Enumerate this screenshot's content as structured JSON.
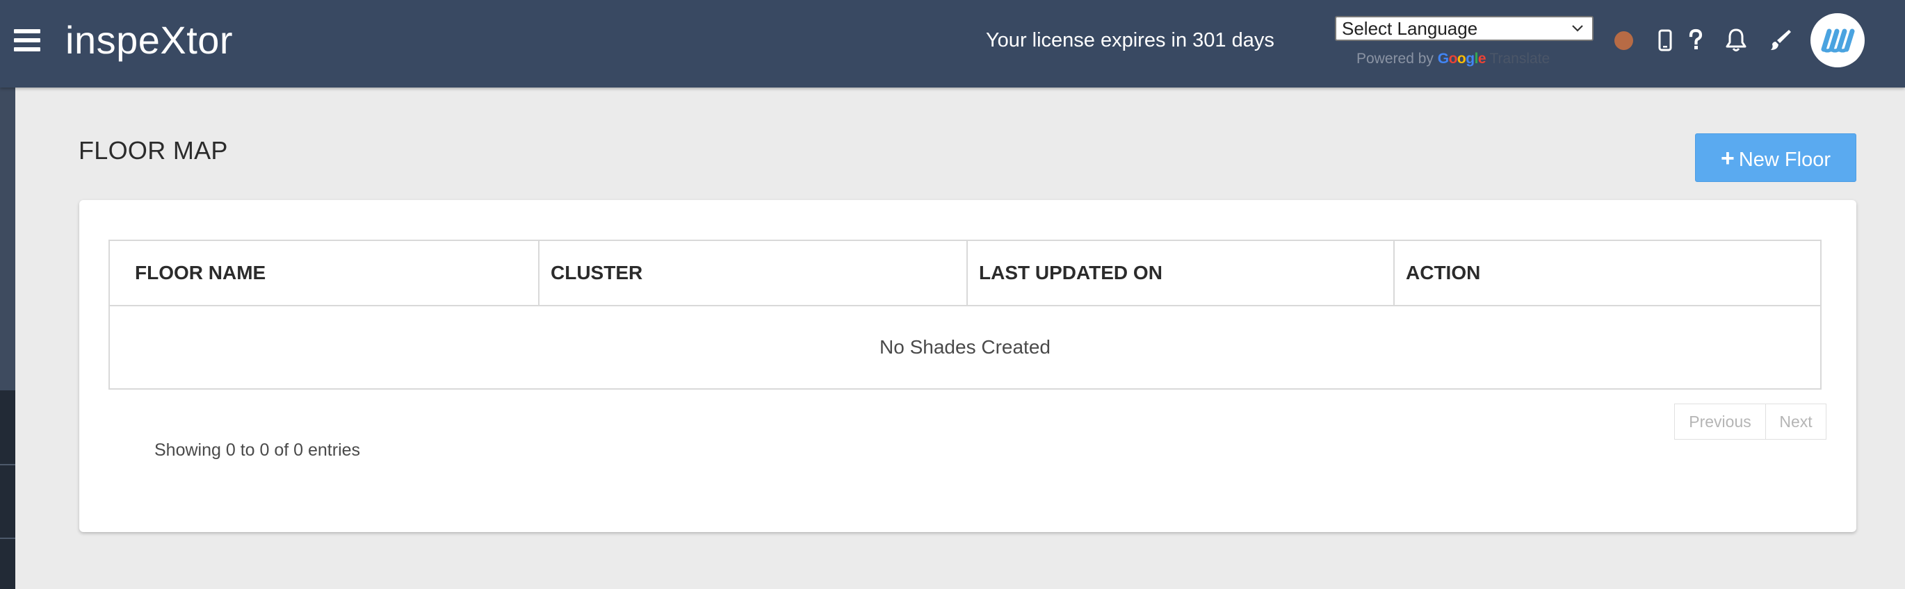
{
  "app": {
    "brand": "inspeXtor"
  },
  "header": {
    "license_text": "Your license expires in 301 days",
    "language_select": {
      "selected": "Select Language",
      "powered_by": "Powered by",
      "google": "Google",
      "translate": "Translate"
    },
    "status_color": "#b76b45",
    "icons": [
      "menu-icon",
      "mobile-icon",
      "help-icon",
      "bell-icon",
      "brush-icon",
      "avatar"
    ]
  },
  "page": {
    "title": "FLOOR MAP",
    "new_button_label": "New Floor"
  },
  "table": {
    "columns": [
      "FLOOR NAME",
      "CLUSTER",
      "LAST UPDATED ON",
      "ACTION"
    ],
    "empty_message": "No Shades Created",
    "info": "Showing 0 to 0 of 0 entries",
    "pager": {
      "previous": "Previous",
      "next": "Next"
    }
  },
  "colors": {
    "topbar": "#394962",
    "accent_button": "#5aaaf0",
    "logo": "#4aa3e0",
    "background": "#ebebeb"
  }
}
